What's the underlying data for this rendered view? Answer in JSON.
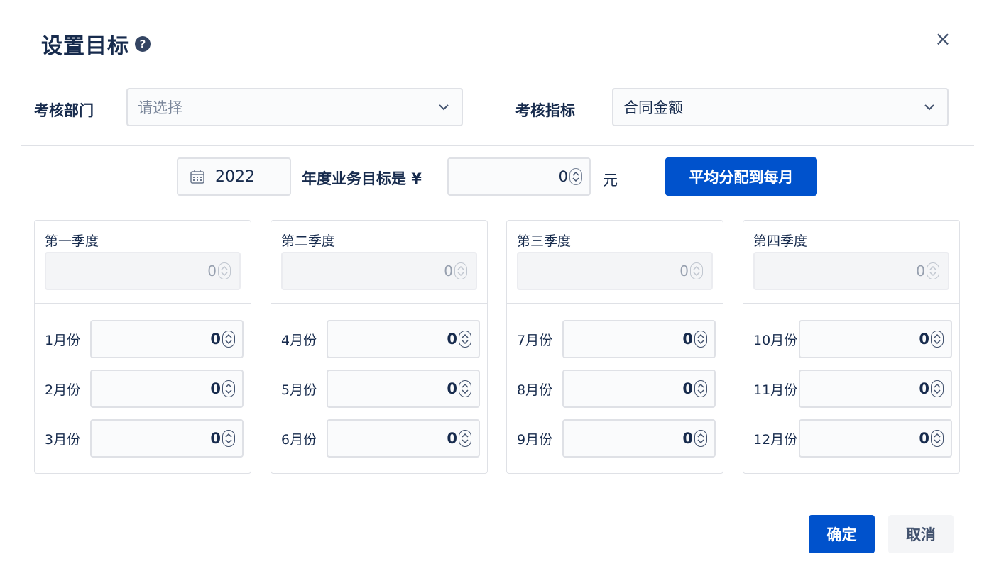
{
  "dialog": {
    "title": "设置目标",
    "help_icon": "question-circle-icon",
    "close_icon": "close-icon",
    "close_glyph": "×"
  },
  "filters": {
    "department_label": "考核部门",
    "department_placeholder": "请选择",
    "metric_label": "考核指标",
    "metric_value": "合同金额"
  },
  "annual": {
    "year": "2022",
    "label": "年度业务目标是 ¥",
    "value": "0",
    "unit": "元",
    "distribute_button": "平均分配到每月"
  },
  "quarters": [
    {
      "title": "第一季度",
      "value": "0",
      "months": [
        {
          "label": "1月份",
          "value": "0"
        },
        {
          "label": "2月份",
          "value": "0"
        },
        {
          "label": "3月份",
          "value": "0"
        }
      ]
    },
    {
      "title": "第二季度",
      "value": "0",
      "months": [
        {
          "label": "4月份",
          "value": "0"
        },
        {
          "label": "5月份",
          "value": "0"
        },
        {
          "label": "6月份",
          "value": "0"
        }
      ]
    },
    {
      "title": "第三季度",
      "value": "0",
      "months": [
        {
          "label": "7月份",
          "value": "0"
        },
        {
          "label": "8月份",
          "value": "0"
        },
        {
          "label": "9月份",
          "value": "0"
        }
      ]
    },
    {
      "title": "第四季度",
      "value": "0",
      "months": [
        {
          "label": "10月份",
          "value": "0"
        },
        {
          "label": "11月份",
          "value": "0"
        },
        {
          "label": "12月份",
          "value": "0"
        }
      ]
    }
  ],
  "footer": {
    "confirm_label": "确定",
    "cancel_label": "取消"
  },
  "colors": {
    "primary": "#0052cc",
    "text": "#172b4d",
    "border": "#dfe1e6"
  }
}
